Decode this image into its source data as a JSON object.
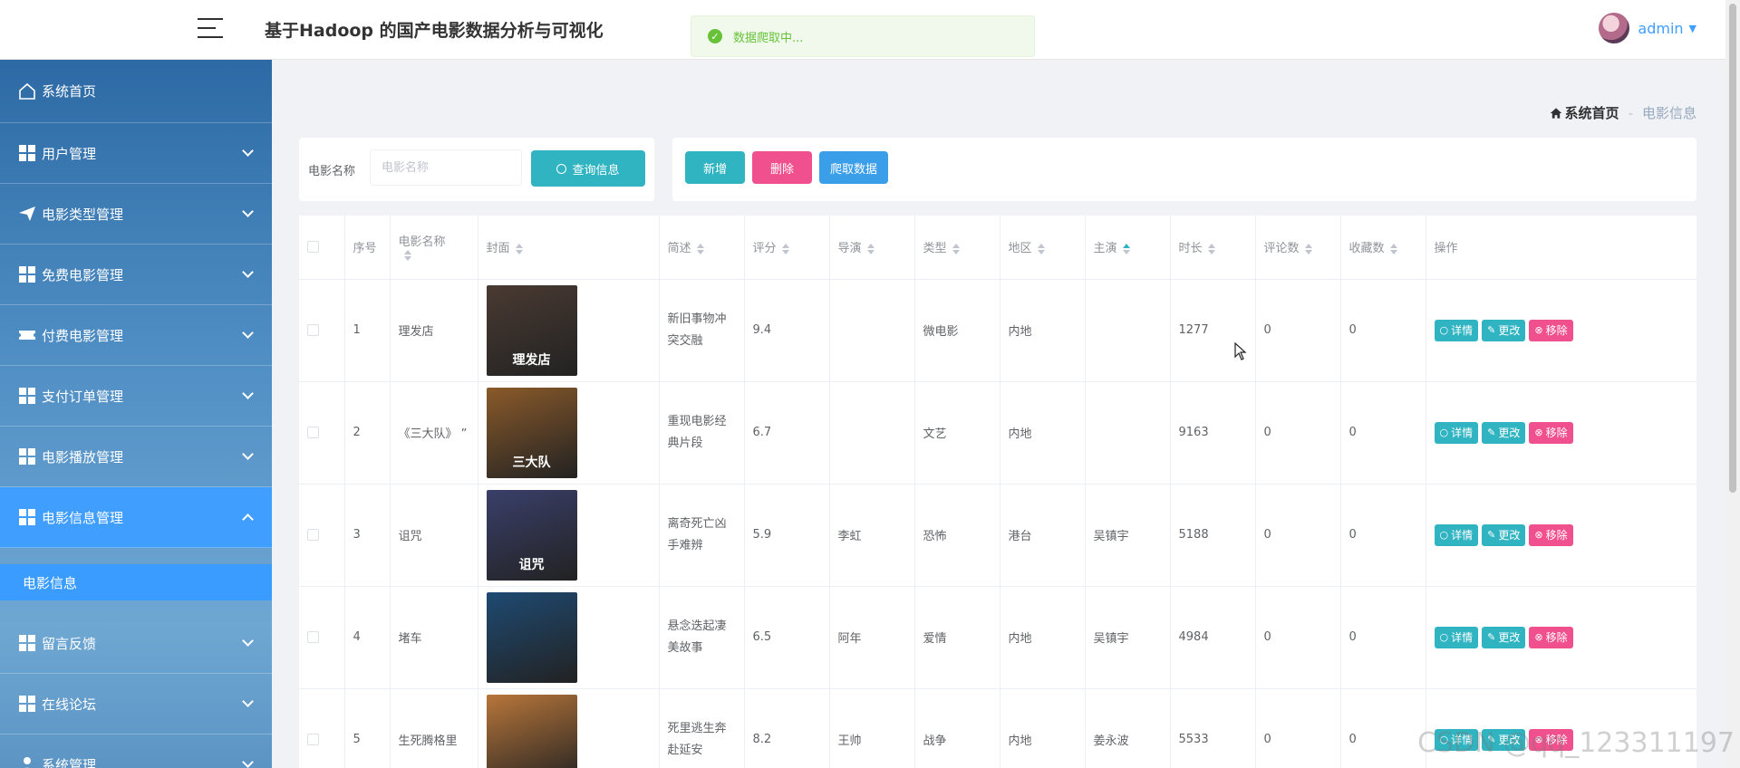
{
  "header": {
    "title": "基于Hadoop 的国产电影数据分析与可视化",
    "toast": "数据爬取中...",
    "user": "admin"
  },
  "sidebar": {
    "items": [
      {
        "label": "系统首页",
        "icon": "home-icon"
      },
      {
        "label": "用户管理",
        "icon": "grid-icon"
      },
      {
        "label": "电影类型管理",
        "icon": "send-icon"
      },
      {
        "label": "免费电影管理",
        "icon": "grid-icon"
      },
      {
        "label": "付费电影管理",
        "icon": "ticket-icon"
      },
      {
        "label": "支付订单管理",
        "icon": "grid-icon"
      },
      {
        "label": "电影播放管理",
        "icon": "grid-icon"
      },
      {
        "label": "电影信息管理",
        "icon": "grid-icon"
      },
      {
        "label": "留言反馈",
        "icon": "grid-icon"
      },
      {
        "label": "在线论坛",
        "icon": "grid-icon"
      },
      {
        "label": "系统管理",
        "icon": "user-icon"
      }
    ],
    "sub_active": "电影信息"
  },
  "breadcrumb": {
    "home": "系统首页",
    "sep": "-",
    "current": "电影信息"
  },
  "search": {
    "label": "电影名称",
    "placeholder": "电影名称",
    "button": "查询信息"
  },
  "actions": {
    "add": "新增",
    "delete": "删除",
    "crawl": "爬取数据"
  },
  "table": {
    "columns": [
      "序号",
      "电影名称",
      "封面",
      "简述",
      "评分",
      "导演",
      "类型",
      "地区",
      "主演",
      "时长",
      "评论数",
      "收藏数",
      "操作"
    ],
    "op_labels": {
      "detail": "详情",
      "edit": "更改",
      "remove": "移除"
    },
    "rows": [
      {
        "no": "1",
        "name": "理发店",
        "desc": "新旧事物冲突交融",
        "score": "9.4",
        "director": "",
        "type": "微电影",
        "region": "内地",
        "star": "",
        "duration": "1277",
        "comments": "0",
        "favorites": "0",
        "cover_color": "#4a3a32",
        "cover_text": "理发店"
      },
      {
        "no": "2",
        "name": "《三大队》 ”",
        "desc": "重现电影经典片段",
        "score": "6.7",
        "director": "",
        "type": "文艺",
        "region": "内地",
        "star": "",
        "duration": "9163",
        "comments": "0",
        "favorites": "0",
        "cover_color": "#8a5a2a",
        "cover_text": "三大队"
      },
      {
        "no": "3",
        "name": "诅咒",
        "desc": "离奇死亡凶手难辨",
        "score": "5.9",
        "director": "李虹",
        "type": "恐怖",
        "region": "港台",
        "star": "吴镇宇",
        "duration": "5188",
        "comments": "0",
        "favorites": "0",
        "cover_color": "#3a3f6a",
        "cover_text": "诅咒"
      },
      {
        "no": "4",
        "name": "堵车",
        "desc": "悬念迭起凄美故事",
        "score": "6.5",
        "director": "阿年",
        "type": "爱情",
        "region": "内地",
        "star": "吴镇宇",
        "duration": "4984",
        "comments": "0",
        "favorites": "0",
        "cover_color": "#1e4a72",
        "cover_text": ""
      },
      {
        "no": "5",
        "name": "生死腾格里",
        "desc": "死里逃生奔赴延安",
        "score": "8.2",
        "director": "王帅",
        "type": "战争",
        "region": "内地",
        "star": "姜永波",
        "duration": "5533",
        "comments": "0",
        "favorites": "0",
        "cover_color": "#b8763a",
        "cover_text": ""
      }
    ]
  },
  "watermark": "CSDN @qq_123311197"
}
